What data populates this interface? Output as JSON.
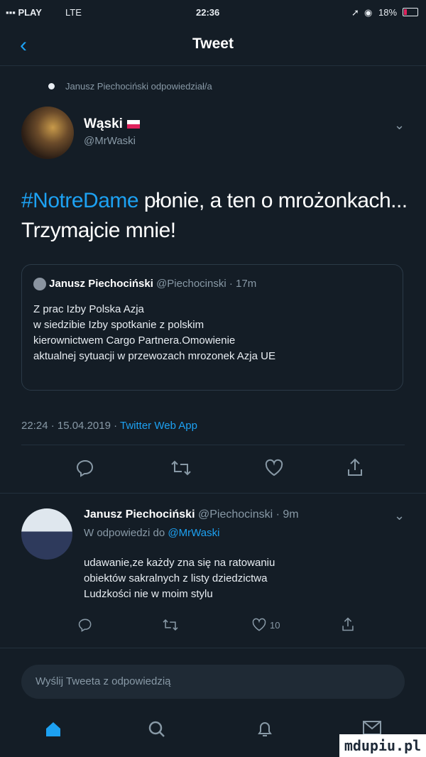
{
  "status_bar": {
    "carrier": "PLAY",
    "network": "LTE",
    "time": "22:36",
    "battery": "18%"
  },
  "nav": {
    "title": "Tweet"
  },
  "reply_context": "Janusz Piechociński odpowiedział/a",
  "author": {
    "name": "Wąski",
    "handle": "@MrWaski"
  },
  "tweet": {
    "hashtag": "#NotreDame",
    "text": " płonie, a ten o mrożonkach... Trzymajcie mnie!"
  },
  "quoted": {
    "name": "Janusz Piechociński",
    "handle": "@Piechocinski",
    "time": "· 17m",
    "lines": [
      "Z prac Izby Polska Azja",
      "w siedzibie Izby spotkanie z polskim",
      "kierownictwem Cargo Partnera.Omowienie",
      "aktualnej sytuacji w przewozach mrozonek Azja UE"
    ]
  },
  "meta": {
    "timestamp": "22:24 · 15.04.2019 · ",
    "source": "Twitter Web App"
  },
  "reply": {
    "name": "Janusz Piechociński",
    "handle": "@Piechocinski",
    "time": "· 9m",
    "replying_prefix": "W odpowiedzi do ",
    "replying_to": "@MrWaski",
    "lines": [
      "udawanie,ze każdy zna się na ratowaniu",
      "obiektów sakralnych z listy dziedzictwa",
      "Ludzkości nie w moim stylu"
    ],
    "like_count": "10"
  },
  "composer": {
    "placeholder": "Wyślij Tweeta z odpowiedzią"
  },
  "watermark": "mdupiu.pl",
  "colors": {
    "background": "#141d26",
    "accent": "#1da1f2",
    "muted": "#8899a6"
  }
}
